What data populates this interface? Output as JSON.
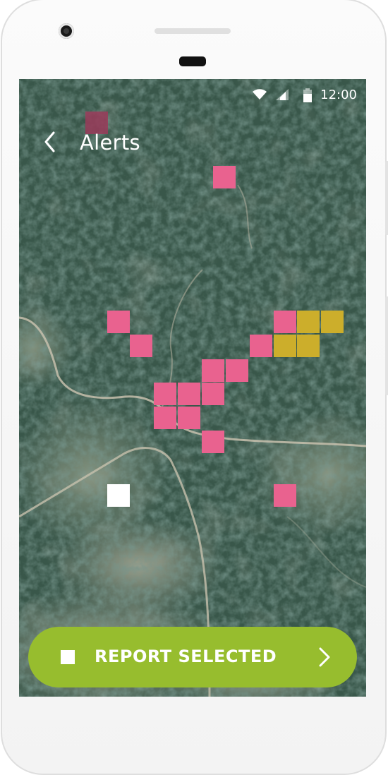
{
  "status_bar": {
    "time": "12:00",
    "icons": [
      "wifi-icon",
      "signal-icon",
      "battery-icon"
    ]
  },
  "app_bar": {
    "back_icon": "chevron-left-icon",
    "title": "Alerts"
  },
  "map": {
    "type": "satellite",
    "alert_colors": {
      "pink": "#e9628f",
      "dark_pink": "#9a3b5b",
      "yellow": "#ccae2b",
      "white": "#ffffff"
    }
  },
  "report_button": {
    "label": "REPORT SELECTED",
    "checkbox_icon": "checkbox-icon",
    "chevron_icon": "chevron-right-icon",
    "color": "#97bd2e"
  }
}
